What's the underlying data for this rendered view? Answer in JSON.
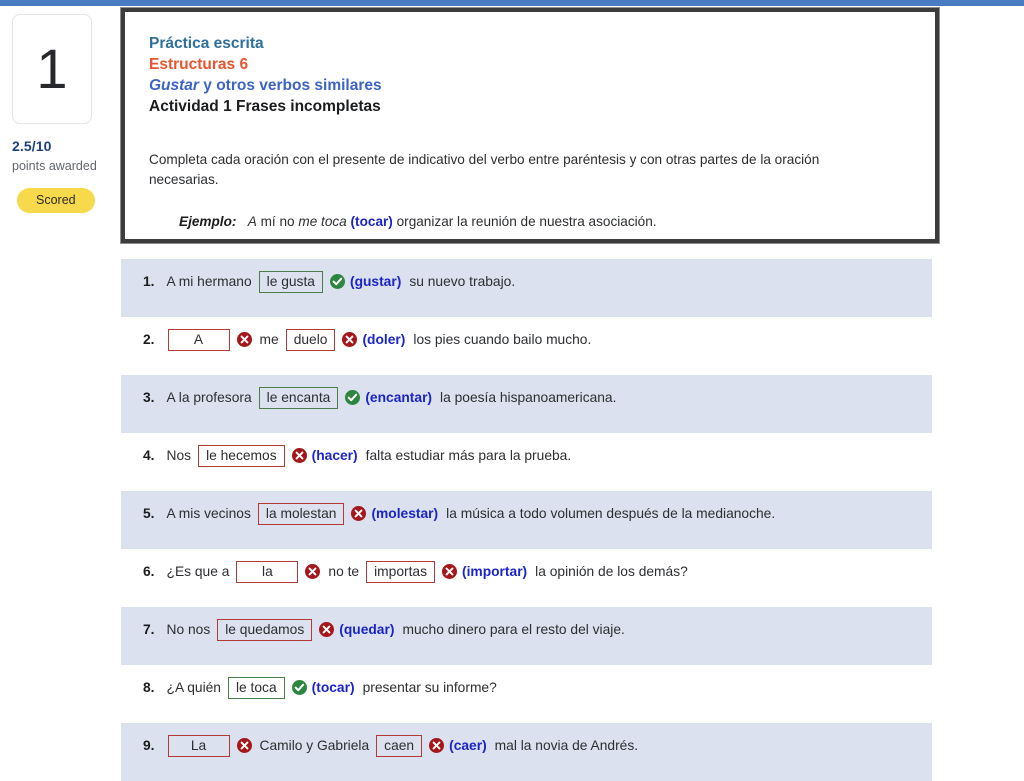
{
  "topbar": {
    "color": "#4a7ac0"
  },
  "sidebar": {
    "question_number": "1",
    "score": "2.5/10",
    "points_label": "points awarded",
    "status_badge": "Scored",
    "badge_color": "#f7d94c"
  },
  "header": {
    "line1": "Práctica escrita",
    "line2": "Estructuras 6",
    "line3_italic": "Gustar",
    "line3_rest": " y otros verbos similares",
    "line4": "Actividad 1 Frases incompletas",
    "instructions": "Completa cada oración con el presente de indicativo del verbo entre paréntesis y con otras partes de la oración necesarias.",
    "example_label": "Ejemplo:",
    "example_pre": "A",
    "example_text1": " mí no ",
    "example_italic": "me toca",
    "example_verb": "(tocar)",
    "example_text2": " organizar la reunión de nuestra asociación."
  },
  "questions": [
    {
      "num": "1.",
      "shaded": true,
      "parts": [
        {
          "type": "text",
          "value": "A mi hermano"
        },
        {
          "type": "answer",
          "value": "le gusta",
          "state": "right"
        },
        {
          "type": "mark",
          "state": "ok"
        },
        {
          "type": "verb",
          "value": "(gustar)"
        },
        {
          "type": "text",
          "value": "su nuevo trabajo."
        }
      ]
    },
    {
      "num": "2.",
      "shaded": false,
      "parts": [
        {
          "type": "answer",
          "value": "A",
          "state": "wrong",
          "wide": true
        },
        {
          "type": "mark",
          "state": "bad"
        },
        {
          "type": "text",
          "value": "me"
        },
        {
          "type": "answer",
          "value": "duelo",
          "state": "wrong"
        },
        {
          "type": "mark",
          "state": "bad"
        },
        {
          "type": "verb",
          "value": "(doler)"
        },
        {
          "type": "text",
          "value": "los pies cuando bailo mucho."
        }
      ]
    },
    {
      "num": "3.",
      "shaded": true,
      "parts": [
        {
          "type": "text",
          "value": "A la profesora"
        },
        {
          "type": "answer",
          "value": "le encanta",
          "state": "right"
        },
        {
          "type": "mark",
          "state": "ok"
        },
        {
          "type": "verb",
          "value": "(encantar)"
        },
        {
          "type": "text",
          "value": "la poesía hispanoamericana."
        }
      ]
    },
    {
      "num": "4.",
      "shaded": false,
      "parts": [
        {
          "type": "text",
          "value": "Nos"
        },
        {
          "type": "answer",
          "value": "le hecemos",
          "state": "wrong"
        },
        {
          "type": "mark",
          "state": "bad"
        },
        {
          "type": "verb",
          "value": "(hacer)"
        },
        {
          "type": "text",
          "value": "falta estudiar más para la prueba."
        }
      ]
    },
    {
      "num": "5.",
      "shaded": true,
      "parts": [
        {
          "type": "text",
          "value": "A mis vecinos"
        },
        {
          "type": "answer",
          "value": "la molestan",
          "state": "wrong"
        },
        {
          "type": "mark",
          "state": "bad"
        },
        {
          "type": "verb",
          "value": "(molestar)"
        },
        {
          "type": "text",
          "value": "la música a todo volumen después de la medianoche."
        }
      ]
    },
    {
      "num": "6.",
      "shaded": false,
      "parts": [
        {
          "type": "text",
          "value": "¿Es que a"
        },
        {
          "type": "answer",
          "value": "la",
          "state": "wrong",
          "wide": true
        },
        {
          "type": "mark",
          "state": "bad"
        },
        {
          "type": "text",
          "value": "no te"
        },
        {
          "type": "answer",
          "value": "importas",
          "state": "wrong"
        },
        {
          "type": "mark",
          "state": "bad"
        },
        {
          "type": "verb",
          "value": "(importar)"
        },
        {
          "type": "text",
          "value": "la opinión de los demás?"
        }
      ]
    },
    {
      "num": "7.",
      "shaded": true,
      "parts": [
        {
          "type": "text",
          "value": "No nos"
        },
        {
          "type": "answer",
          "value": "le quedamos",
          "state": "wrong"
        },
        {
          "type": "mark",
          "state": "bad"
        },
        {
          "type": "verb",
          "value": "(quedar)"
        },
        {
          "type": "text",
          "value": "mucho dinero para el resto del viaje."
        }
      ]
    },
    {
      "num": "8.",
      "shaded": false,
      "parts": [
        {
          "type": "text",
          "value": "¿A quién"
        },
        {
          "type": "answer",
          "value": "le toca",
          "state": "right"
        },
        {
          "type": "mark",
          "state": "ok"
        },
        {
          "type": "verb",
          "value": "(tocar)"
        },
        {
          "type": "text",
          "value": "presentar su informe?"
        }
      ]
    },
    {
      "num": "9.",
      "shaded": true,
      "parts": [
        {
          "type": "answer",
          "value": "La",
          "state": "wrong",
          "wide": true
        },
        {
          "type": "mark",
          "state": "bad"
        },
        {
          "type": "text",
          "value": "Camilo y Gabriela"
        },
        {
          "type": "answer",
          "value": "caen",
          "state": "wrong"
        },
        {
          "type": "mark",
          "state": "bad"
        },
        {
          "type": "verb",
          "value": "(caer)"
        },
        {
          "type": "text",
          "value": "mal la novia de Andrés."
        }
      ]
    }
  ]
}
